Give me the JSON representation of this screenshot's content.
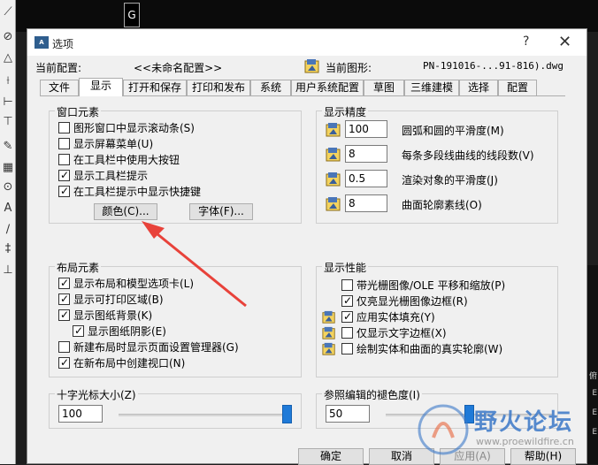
{
  "cad": {
    "command_glyph": "G",
    "right_text": [
      "俯",
      "E",
      "E",
      "E"
    ]
  },
  "dialog": {
    "title": "选项",
    "help_glyph": "?",
    "close_glyph": "✕",
    "current_profile_label": "当前配置:",
    "current_profile_value": "<<未命名配置>>",
    "current_drawing_label": "当前图形:",
    "current_drawing_value": "PN-191016-...91-816).dwg"
  },
  "tabs": [
    {
      "label": "文件"
    },
    {
      "label": "显示"
    },
    {
      "label": "打开和保存"
    },
    {
      "label": "打印和发布"
    },
    {
      "label": "系统"
    },
    {
      "label": "用户系统配置"
    },
    {
      "label": "草图"
    },
    {
      "label": "三维建模"
    },
    {
      "label": "选择"
    },
    {
      "label": "配置"
    }
  ],
  "active_tab": "显示",
  "window_elements": {
    "title": "窗口元素",
    "checkboxes": [
      {
        "label": "图形窗口中显示滚动条(S)",
        "checked": false
      },
      {
        "label": "显示屏幕菜单(U)",
        "checked": false
      },
      {
        "label": "在工具栏中使用大按钮",
        "checked": false
      },
      {
        "label": "显示工具栏提示",
        "checked": true
      },
      {
        "label": "在工具栏提示中显示快捷键",
        "checked": true
      }
    ],
    "colors_button": "颜色(C)...",
    "fonts_button": "字体(F)..."
  },
  "layout_elements": {
    "title": "布局元素",
    "checkboxes": [
      {
        "label": "显示布局和模型选项卡(L)",
        "checked": true
      },
      {
        "label": "显示可打印区域(B)",
        "checked": true
      },
      {
        "label": "显示图纸背景(K)",
        "checked": true
      },
      {
        "label": "显示图纸阴影(E)",
        "checked": true
      },
      {
        "label": "新建布局时显示页面设置管理器(G)",
        "checked": false
      },
      {
        "label": "在新布局中创建视口(N)",
        "checked": true
      }
    ]
  },
  "display_resolution": {
    "title": "显示精度",
    "rows": [
      {
        "value": "100",
        "label": "圆弧和圆的平滑度(M)"
      },
      {
        "value": "8",
        "label": "每条多段线曲线的线段数(V)"
      },
      {
        "value": "0.5",
        "label": "渲染对象的平滑度(J)"
      },
      {
        "value": "8",
        "label": "曲面轮廓素线(O)"
      }
    ]
  },
  "display_performance": {
    "title": "显示性能",
    "checkboxes": [
      {
        "label": "带光栅图像/OLE 平移和缩放(P)",
        "checked": false
      },
      {
        "label": "仅亮显光栅图像边框(R)",
        "checked": true
      },
      {
        "label": "应用实体填充(Y)",
        "checked": true
      },
      {
        "label": "仅显示文字边框(X)",
        "checked": false
      },
      {
        "label": "绘制实体和曲面的真实轮廓(W)",
        "checked": false
      }
    ]
  },
  "crosshair": {
    "title": "十字光标大小(Z)",
    "value": "100",
    "level": 1.0
  },
  "fade": {
    "title": "参照编辑的褪色度(I)",
    "value": "50",
    "level": 0.5
  },
  "footer": {
    "ok": "确定",
    "cancel": "取消",
    "apply": "应用(A)",
    "help": "帮助(H)"
  },
  "watermark": {
    "text": "野火论坛",
    "url": "www.proewildfire.cn"
  },
  "colors": {
    "accent": "#1f7ad8",
    "arrow": "#e8423a"
  }
}
